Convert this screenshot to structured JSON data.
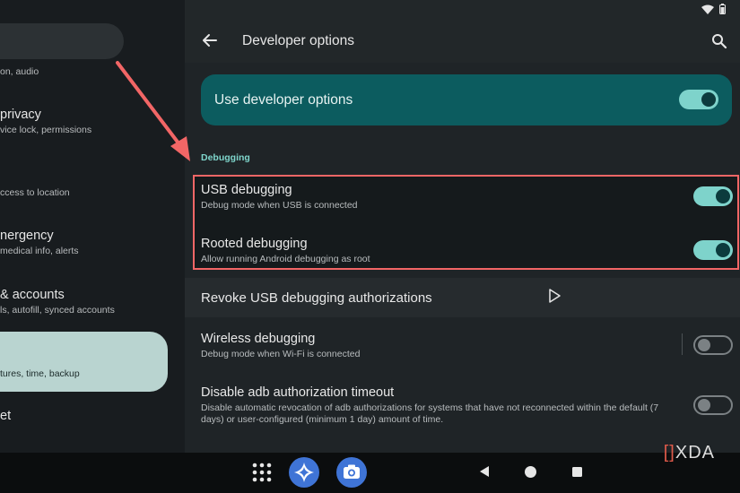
{
  "left_menu": {
    "items": [
      {
        "title": "",
        "subtitle": "on, audio"
      },
      {
        "title": "privacy",
        "subtitle": "vice lock, permissions"
      },
      {
        "title": "",
        "subtitle": "ccess to location"
      },
      {
        "title": "nergency",
        "subtitle": "medical info, alerts"
      },
      {
        "title": "& accounts",
        "subtitle": "ls, autofill, synced accounts"
      },
      {
        "title": "",
        "subtitle": "tures, time, backup"
      },
      {
        "title": "et",
        "subtitle": ""
      }
    ]
  },
  "header": {
    "title": "Developer options"
  },
  "master_switch": {
    "label": "Use developer options",
    "enabled": true
  },
  "section": {
    "label": "Debugging"
  },
  "settings": [
    {
      "title": "USB debugging",
      "subtitle": "Debug mode when USB is connected",
      "toggle": "on"
    },
    {
      "title": "Rooted debugging",
      "subtitle": "Allow running Android debugging as root",
      "toggle": "on"
    },
    {
      "title": "Revoke USB debugging authorizations",
      "subtitle": ""
    },
    {
      "title": "Wireless debugging",
      "subtitle": "Debug mode when Wi-Fi is connected",
      "toggle": "off"
    },
    {
      "title": "Disable adb authorization timeout",
      "subtitle_line1": "Disable automatic revocation of adb authorizations for systems that have not reconnected within the default (7",
      "subtitle_line2": "days) or user-configured (minimum 1 day) amount of time.",
      "toggle": "off"
    }
  ],
  "watermark": {
    "text": "XDA"
  },
  "colors": {
    "accent": "#7ed3cb",
    "master_card": "#0c5c5f",
    "highlight": "#f26666"
  },
  "icons": [
    "back-arrow-icon",
    "search-icon",
    "wifi-icon",
    "battery-icon",
    "app-grid-icon",
    "assistant-icon",
    "camera-icon",
    "nav-back-icon",
    "nav-home-icon",
    "nav-recents-icon"
  ]
}
